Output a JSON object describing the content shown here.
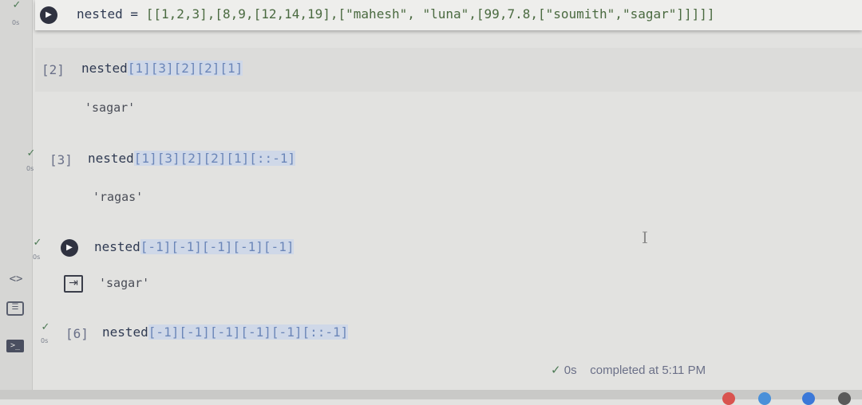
{
  "sidebar": {
    "items": [
      {
        "name": "code-icon",
        "glyph": "<>"
      },
      {
        "name": "text-icon",
        "glyph": "☰"
      },
      {
        "name": "terminal-icon",
        "glyph": ">_"
      }
    ]
  },
  "cells": [
    {
      "exec_label": "",
      "time": "0s",
      "code_plain": "nested = ",
      "code_rest": "[[1,2,3],[8,9,[12,14,19],[\"mahesh\", \"luna\",[99,7.8,[\"soumith\",\"sagar\"]]]]]",
      "output": ""
    },
    {
      "exec_label": "[2]",
      "time": "",
      "code_plain": "nested",
      "code_rest": "[1][3][2][2][1]",
      "output": "'sagar'"
    },
    {
      "exec_label": "[3]",
      "time": "0s",
      "code_plain": "nested",
      "code_rest": "[1][3][2][2][1][::-1]",
      "output": "'ragas'"
    },
    {
      "exec_label": "",
      "time": "0s",
      "code_plain": "nested",
      "code_rest": "[-1][-1][-1][-1][-1]",
      "output": "'sagar'"
    },
    {
      "exec_label": "[6]",
      "time": "0s",
      "code_plain": "nested",
      "code_rest": "[-1][-1][-1][-1][-1][::-1]",
      "output": ""
    }
  ],
  "status": {
    "check": "✓",
    "duration": "0s",
    "text": "completed at 5:11 PM"
  }
}
